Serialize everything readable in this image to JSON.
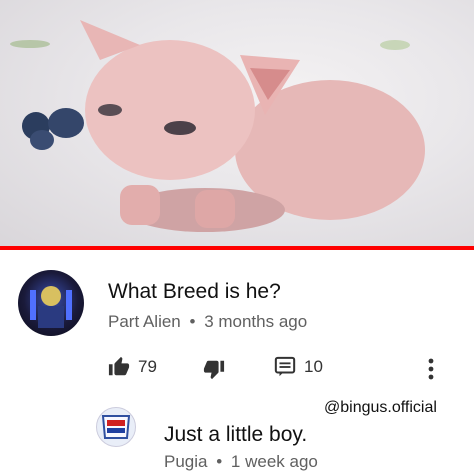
{
  "comment": {
    "author": "Part Alien",
    "time": "3 months ago",
    "text": "What Breed is he?",
    "likes": "79",
    "replies": "10"
  },
  "reply": {
    "author": "Pugia",
    "time": "1 week ago",
    "text": "Just a little boy."
  },
  "watermark": "@bingus.official",
  "separator": "•",
  "colors": {
    "progress": "#ff0000",
    "meta": "#606060"
  },
  "icons": [
    "thumbs-up-icon",
    "thumbs-down-icon",
    "reply-icon",
    "more-vertical-icon"
  ]
}
